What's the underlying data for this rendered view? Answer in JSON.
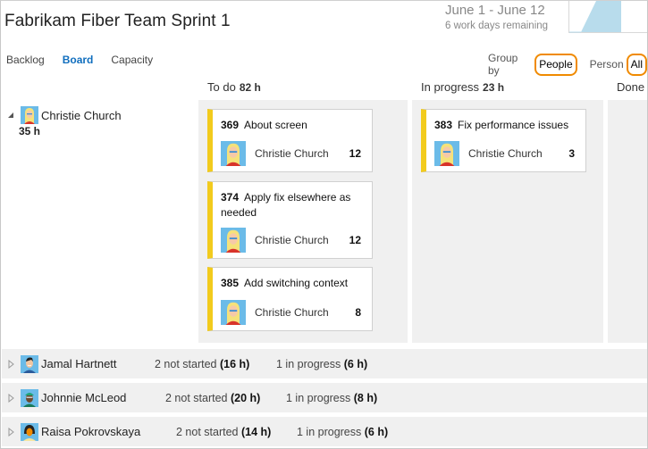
{
  "header": {
    "title": "Fabrikam Fiber Team Sprint 1",
    "date_range": "June 1 - June 12",
    "days_remaining": "6 work days remaining"
  },
  "nav": {
    "tabs": [
      {
        "label": "Backlog",
        "active": false
      },
      {
        "label": "Board",
        "active": true
      },
      {
        "label": "Capacity",
        "active": false
      }
    ]
  },
  "filters": {
    "group_by_label": "Group by",
    "group_by_value": "People",
    "person_label": "Person",
    "person_value": "All",
    "highlight_color": "#f08a00"
  },
  "columns": [
    {
      "name": "To do",
      "hours": "82 h"
    },
    {
      "name": "In progress",
      "hours": "23 h"
    },
    {
      "name": "Done",
      "hours": ""
    }
  ],
  "expanded_person": {
    "name": "Christie Church",
    "hours": "35 h",
    "avatar": "christie-avatar",
    "todo": [
      {
        "id": "369",
        "title": "About screen",
        "assignee": "Christie Church",
        "remaining": "12"
      },
      {
        "id": "374",
        "title": "Apply fix elsewhere as needed",
        "assignee": "Christie Church",
        "remaining": "12"
      },
      {
        "id": "385",
        "title": "Add switching context",
        "assignee": "Christie Church",
        "remaining": "8"
      }
    ],
    "in_progress": [
      {
        "id": "383",
        "title": "Fix performance issues",
        "assignee": "Christie Church",
        "remaining": "3"
      }
    ]
  },
  "collapsed_people": [
    {
      "name": "Jamal Hartnett",
      "avatar": "jamal-avatar",
      "not_started_text": "2 not started",
      "not_started_hours": "(16 h)",
      "in_progress_text": "1 in progress",
      "in_progress_hours": "(6 h)"
    },
    {
      "name": "Johnnie McLeod",
      "avatar": "johnnie-avatar",
      "not_started_text": "2 not started",
      "not_started_hours": "(20 h)",
      "in_progress_text": "1 in progress",
      "in_progress_hours": "(8 h)"
    },
    {
      "name": "Raisa Pokrovskaya",
      "avatar": "raisa-avatar",
      "not_started_text": "2 not started",
      "not_started_hours": "(14 h)",
      "in_progress_text": "1 in progress",
      "in_progress_hours": "(6 h)"
    }
  ],
  "colors": {
    "accent": "#106ebe",
    "card_bar": "#f2cb1d",
    "lane_bg": "#f0f0f0",
    "burndown_fill": "#b8dcec"
  }
}
